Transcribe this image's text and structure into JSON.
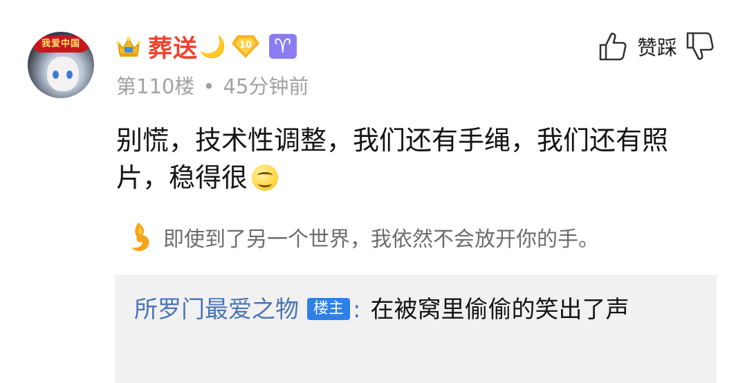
{
  "post": {
    "username": "葬送",
    "moon_emoji": "🌙",
    "level_badge": "10",
    "zodiac_symbol": "♈",
    "floor": "第110楼",
    "separator": "•",
    "time": "45分钟前",
    "content": "别慌，技术性调整，我们还有手绳，我们还有照片，稳得很",
    "signature": "即使到了另一个世界，我依然不会放开你的手。",
    "avatar_text": "我爱中国"
  },
  "vote": {
    "label": "赞踩",
    "like_icon": "thumb-up-icon",
    "dislike_icon": "thumb-down-icon"
  },
  "reply": {
    "author": "所罗门最爱之物",
    "author_tag": "楼主",
    "colon": ":",
    "text": "在被窝里偷偷的笑出了声"
  },
  "colors": {
    "username": "#f0412d",
    "reply_author": "#4a74b8",
    "tag_bg": "#2f7fe8",
    "reply_bg": "#f1f1f1",
    "meta": "#a2a2a2"
  }
}
